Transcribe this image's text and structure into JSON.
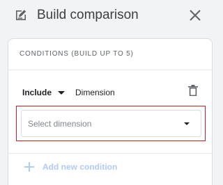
{
  "header": {
    "title": "Build comparison",
    "icon": "edit-square-icon",
    "close_icon": "close-icon"
  },
  "conditions": {
    "section_title": "CONDITIONS (BUILD UP TO 5)",
    "include_label": "Include",
    "dimension_label": "Dimension",
    "delete_icon": "trash-icon",
    "select": {
      "placeholder": "Select dimension",
      "value": ""
    },
    "add_condition_label": "Add new condition",
    "add_condition_enabled": false
  },
  "colors": {
    "background": "#f1f3f4",
    "card": "#ffffff",
    "error_outline": "#c5221f",
    "disabled_link": "#aecbfa"
  }
}
